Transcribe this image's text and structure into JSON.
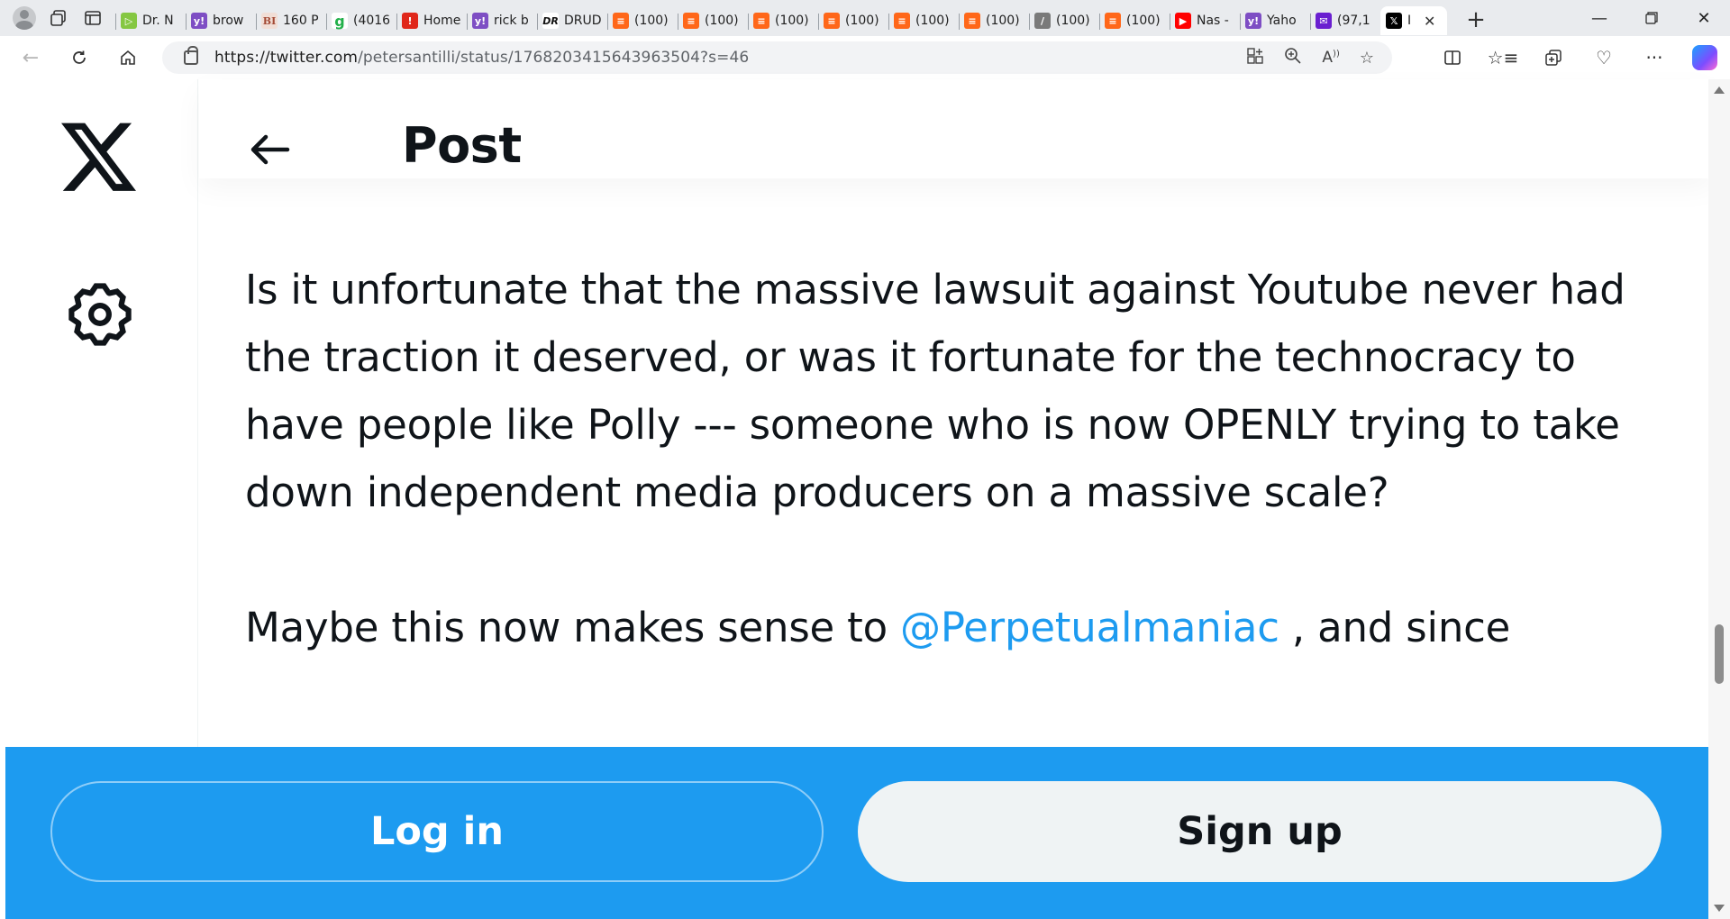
{
  "browser": {
    "tabs": [
      {
        "title": "Dr. N",
        "favicon": "rumble-icon"
      },
      {
        "title": "brow",
        "favicon": "yahoo-icon"
      },
      {
        "title": "160 P",
        "favicon": "bi-icon"
      },
      {
        "title": "(4016",
        "favicon": "green-g-icon"
      },
      {
        "title": "Home",
        "favicon": "red-icon"
      },
      {
        "title": "rick b",
        "favicon": "yahoo-icon"
      },
      {
        "title": "DRUD",
        "favicon": "drudge-icon"
      },
      {
        "title": "(100)",
        "favicon": "substack-icon"
      },
      {
        "title": "(100)",
        "favicon": "substack-icon"
      },
      {
        "title": "(100)",
        "favicon": "substack-icon"
      },
      {
        "title": "(100)",
        "favicon": "substack-icon"
      },
      {
        "title": "(100)",
        "favicon": "substack-icon"
      },
      {
        "title": "(100)",
        "favicon": "substack-icon"
      },
      {
        "title": "(100)",
        "favicon": "feather-icon"
      },
      {
        "title": "(100)",
        "favicon": "substack-icon"
      },
      {
        "title": "Nas -",
        "favicon": "youtube-icon"
      },
      {
        "title": "Yaho",
        "favicon": "yahoo-icon"
      },
      {
        "title": "(97,1",
        "favicon": "mail-icon"
      },
      {
        "title": "I",
        "favicon": "x-icon",
        "active": true
      }
    ],
    "url": {
      "host": "https://twitter.com",
      "path": "/petersantilli/status/1768203415643963504?s=46"
    }
  },
  "page": {
    "header_title": "Post",
    "tweet": {
      "paragraph_1": "Is it unfortunate that the massive lawsuit against Youtube never had the traction it deserved, or was it fortunate for the technocracy to have people like Polly --- someone who is now OPENLY trying to take down independent media producers on a massive scale?",
      "paragraph_2_before": "Maybe this now makes sense to ",
      "mention": "@Perpetualmaniac",
      "paragraph_2_after": " , and since"
    }
  },
  "login_bar": {
    "login_label": "Log in",
    "signup_label": "Sign up"
  },
  "colors": {
    "brand_blue": "#1d9bf0",
    "text": "#0f1419",
    "signup_bg": "#eff3f4"
  }
}
